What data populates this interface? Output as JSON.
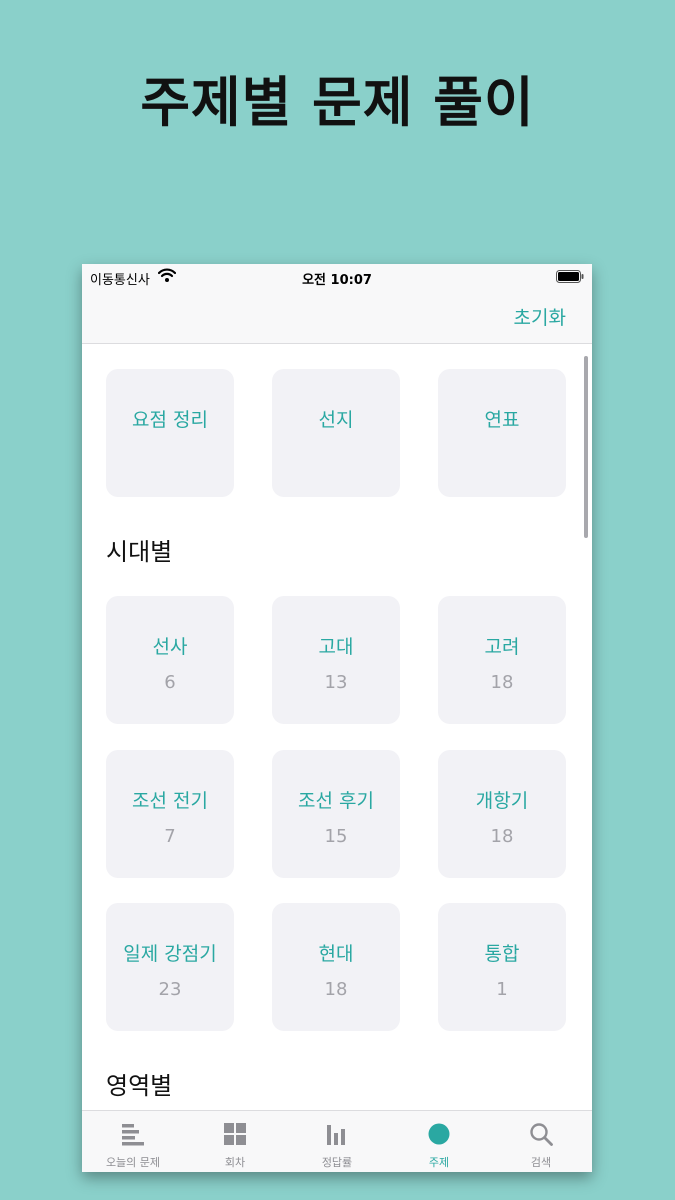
{
  "promo": {
    "title": "주제별 문제 풀이"
  },
  "status_bar": {
    "carrier": "이동통신사",
    "time": "오전 10:07"
  },
  "nav": {
    "reset_label": "초기화"
  },
  "top_tiles": [
    {
      "label": "요점 정리"
    },
    {
      "label": "선지"
    },
    {
      "label": "연표"
    }
  ],
  "sections": [
    {
      "title": "시대별",
      "tiles": [
        {
          "label": "선사",
          "count": "6"
        },
        {
          "label": "고대",
          "count": "13"
        },
        {
          "label": "고려",
          "count": "18"
        },
        {
          "label": "조선 전기",
          "count": "7"
        },
        {
          "label": "조선 후기",
          "count": "15"
        },
        {
          "label": "개항기",
          "count": "18"
        },
        {
          "label": "일제 강점기",
          "count": "23"
        },
        {
          "label": "현대",
          "count": "18"
        },
        {
          "label": "통합",
          "count": "1"
        }
      ]
    },
    {
      "title": "영역별",
      "tiles": []
    }
  ],
  "tab_bar": {
    "active_index": 3,
    "accent_color": "#2aa8a2",
    "tabs": [
      {
        "label": "오늘의 문제",
        "icon": "list-bars-icon"
      },
      {
        "label": "회차",
        "icon": "grid-icon"
      },
      {
        "label": "정답률",
        "icon": "bar-chart-icon"
      },
      {
        "label": "주제",
        "icon": "circle-icon"
      },
      {
        "label": "검색",
        "icon": "magnifier-icon"
      }
    ]
  }
}
